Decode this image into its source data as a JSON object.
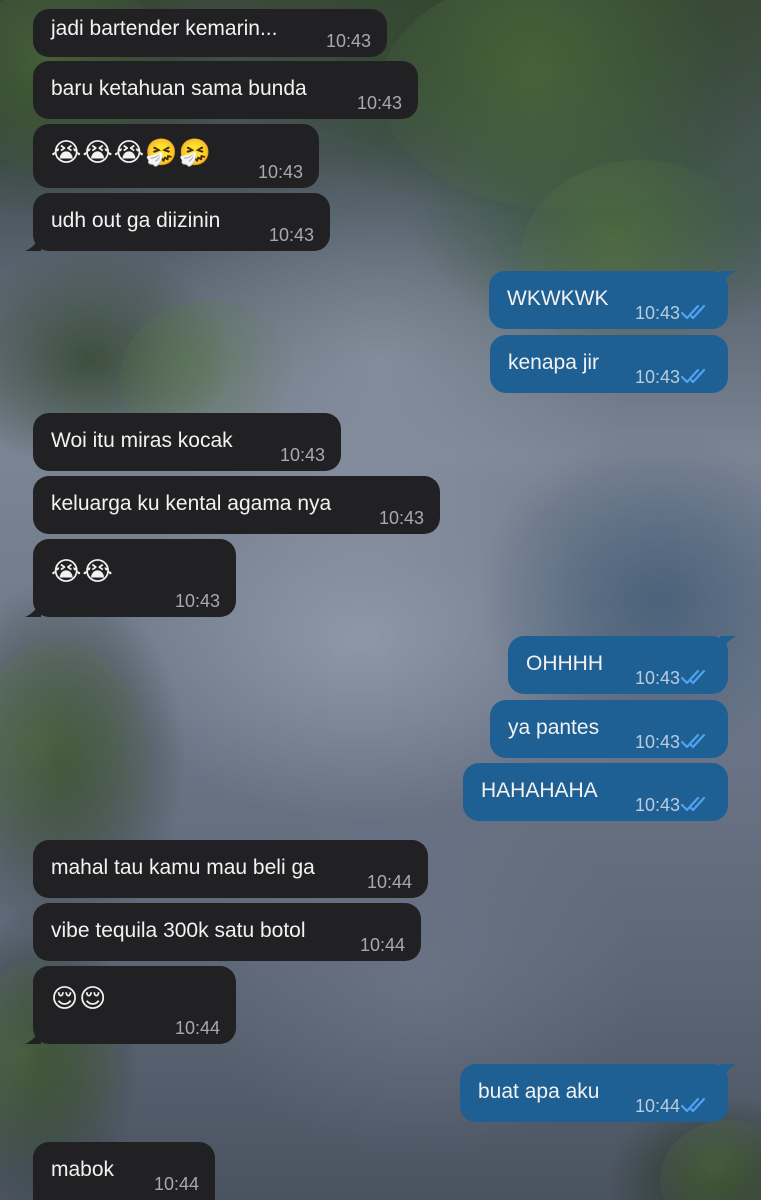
{
  "chat": {
    "messages": [
      {
        "dir": "in",
        "text": "jadi bartender kemarin...",
        "time": "10:43"
      },
      {
        "dir": "in",
        "text": "baru ketahuan sama bunda",
        "time": "10:43"
      },
      {
        "dir": "in",
        "text": "😭😭😭🤧🤧",
        "time": "10:43"
      },
      {
        "dir": "in",
        "text": "udh out ga diizinin",
        "time": "10:43"
      },
      {
        "dir": "out",
        "text": "WKWKWK",
        "time": "10:43",
        "status": "read"
      },
      {
        "dir": "out",
        "text": "kenapa jir",
        "time": "10:43",
        "status": "read"
      },
      {
        "dir": "in",
        "text": "Woi itu miras kocak",
        "time": "10:43"
      },
      {
        "dir": "in",
        "text": "keluarga ku kental agama nya",
        "time": "10:43"
      },
      {
        "dir": "in",
        "text": "😭😭",
        "time": "10:43"
      },
      {
        "dir": "out",
        "text": "OHHHH",
        "time": "10:43",
        "status": "read"
      },
      {
        "dir": "out",
        "text": "ya pantes",
        "time": "10:43",
        "status": "read"
      },
      {
        "dir": "out",
        "text": "HAHAHAHA",
        "time": "10:43",
        "status": "read"
      },
      {
        "dir": "in",
        "text": "mahal tau kamu mau beli ga",
        "time": "10:44"
      },
      {
        "dir": "in",
        "text": "vibe tequila 300k satu botol",
        "time": "10:44"
      },
      {
        "dir": "in",
        "text": "😌😌",
        "time": "10:44"
      },
      {
        "dir": "out",
        "text": "buat apa aku",
        "time": "10:44",
        "status": "read"
      },
      {
        "dir": "in",
        "text": "mabok",
        "time": "10:44"
      }
    ]
  },
  "colors": {
    "incoming_bubble": "#212123",
    "outgoing_bubble": "#1e5f94",
    "read_ticks": "#4fa3f0",
    "text": "#f2f2f2"
  },
  "icons": {
    "read_status": "double-check-icon"
  }
}
